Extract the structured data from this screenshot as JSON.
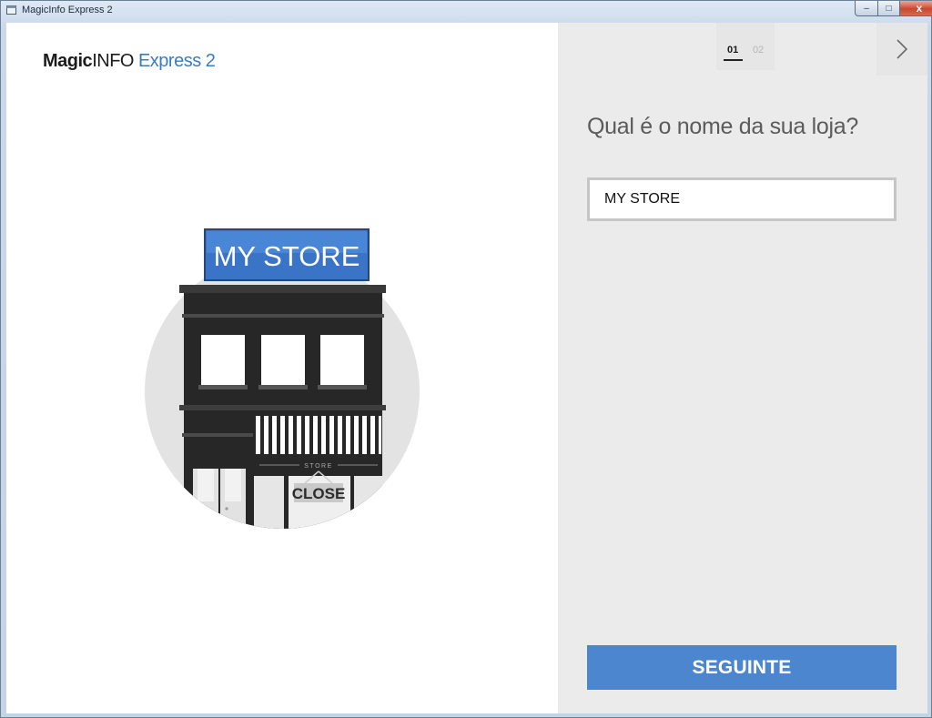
{
  "window": {
    "title": "MagicInfo Express 2",
    "controls": {
      "minimize": "–",
      "maximize": "□",
      "close": "x"
    }
  },
  "logo": {
    "magic": "Magic",
    "info": "INFO",
    "express": "Express 2"
  },
  "illustration": {
    "sign_text": "MY STORE",
    "awning_text": "STORE",
    "door_sign_text": "CLOSE"
  },
  "wizard": {
    "steps": [
      {
        "label": "01",
        "active": true
      },
      {
        "label": "02",
        "active": false
      }
    ],
    "question": "Qual é o nome da sua loja?",
    "store_name_value": "MY STORE",
    "next_button_label": "SEGUINTE"
  },
  "colors": {
    "accent": "#4b86cf",
    "sign_blue": "#3a74c7",
    "right_panel": "#ebebeb",
    "building": "#272727"
  },
  "icons": {
    "next_step": "chevron-right-icon",
    "app": "app-window-icon"
  }
}
